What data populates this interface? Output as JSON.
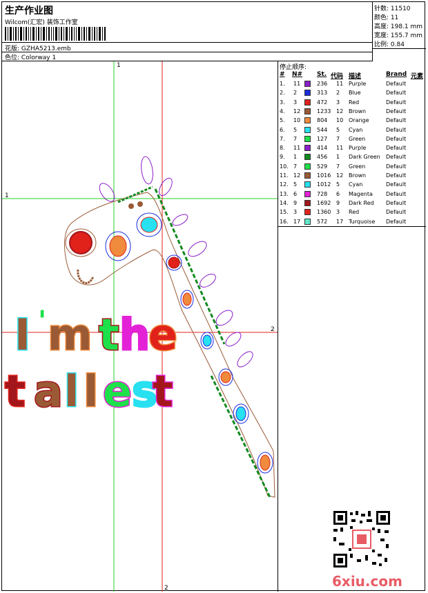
{
  "header": {
    "title": "生产作业图",
    "company": "Wilcom(汇宏) 装饰工作室",
    "pattern_label": "花版:",
    "pattern_value": "GZHA5213.emb",
    "colorway_label": "色位:",
    "colorway_value": "Colorway 1"
  },
  "stats": {
    "stitches": "针数: 11510",
    "colors": "颜色: 11",
    "height": "高度: 198.1 mm",
    "width": "宽度: 155.7 mm",
    "scale": "比例: 0.84"
  },
  "legend": {
    "title": "停止顺序:",
    "headers": {
      "num": "#",
      "no": "N#",
      "st": "St.",
      "code": "代码",
      "desc": "描述",
      "brand": "Brand",
      "element": "元素"
    },
    "rows": [
      {
        "n": "1.",
        "no": "11",
        "color": "#8b1ec9",
        "st": "236",
        "code": "11",
        "desc": "Purple",
        "brand": "Default"
      },
      {
        "n": "2.",
        "no": "2",
        "color": "#1b2de0",
        "st": "313",
        "code": "2",
        "desc": "Blue",
        "brand": "Default"
      },
      {
        "n": "3.",
        "no": "3",
        "color": "#e0221b",
        "st": "472",
        "code": "3",
        "desc": "Red",
        "brand": "Default"
      },
      {
        "n": "4.",
        "no": "12",
        "color": "#9a5a35",
        "st": "1233",
        "code": "12",
        "desc": "Brown",
        "brand": "Default"
      },
      {
        "n": "5.",
        "no": "10",
        "color": "#f08a3c",
        "st": "804",
        "code": "10",
        "desc": "Orange",
        "brand": "Default"
      },
      {
        "n": "6.",
        "no": "5",
        "color": "#27e0f0",
        "st": "544",
        "code": "5",
        "desc": "Cyan",
        "brand": "Default"
      },
      {
        "n": "7.",
        "no": "7",
        "color": "#1ee04a",
        "st": "127",
        "code": "7",
        "desc": "Green",
        "brand": "Default"
      },
      {
        "n": "8.",
        "no": "11",
        "color": "#8b1ec9",
        "st": "414",
        "code": "11",
        "desc": "Purple",
        "brand": "Default"
      },
      {
        "n": "9.",
        "no": "1",
        "color": "#118a1e",
        "st": "456",
        "code": "1",
        "desc": "Dark Green",
        "brand": "Default"
      },
      {
        "n": "10.",
        "no": "7",
        "color": "#1ee04a",
        "st": "529",
        "code": "7",
        "desc": "Green",
        "brand": "Default"
      },
      {
        "n": "11.",
        "no": "12",
        "color": "#9a5a35",
        "st": "1016",
        "code": "12",
        "desc": "Brown",
        "brand": "Default"
      },
      {
        "n": "12.",
        "no": "5",
        "color": "#27e0f0",
        "st": "1012",
        "code": "5",
        "desc": "Cyan",
        "brand": "Default"
      },
      {
        "n": "13.",
        "no": "6",
        "color": "#e322d8",
        "st": "728",
        "code": "6",
        "desc": "Magenta",
        "brand": "Default"
      },
      {
        "n": "14.",
        "no": "9",
        "color": "#a3161b",
        "st": "1692",
        "code": "9",
        "desc": "Dark Red",
        "brand": "Default"
      },
      {
        "n": "15.",
        "no": "3",
        "color": "#e0221b",
        "st": "1360",
        "code": "3",
        "desc": "Red",
        "brand": "Default"
      },
      {
        "n": "16.",
        "no": "17",
        "color": "#5fe8c9",
        "st": "572",
        "code": "17",
        "desc": "Turquoise",
        "brand": "Default"
      }
    ]
  },
  "canvas": {
    "axis_labels": {
      "top": "1",
      "left": "1",
      "right": "2",
      "bottom": "2"
    },
    "text_line1": "I'm the",
    "text_line2": "tallest"
  },
  "watermark": "6xiu.com"
}
